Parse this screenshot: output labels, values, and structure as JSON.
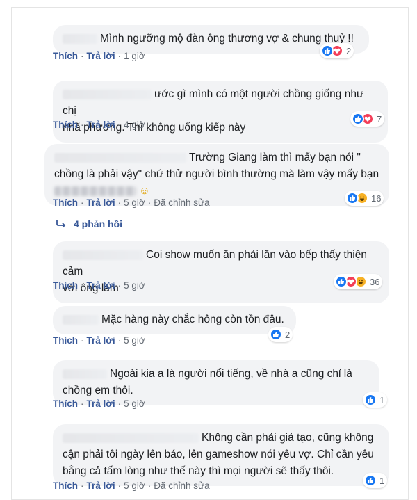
{
  "colors": {
    "link": "#385898",
    "bubble": "#f2f3f5",
    "like": "#1877f2",
    "love": "#f33e58",
    "haha": "#f7b125",
    "muted": "#606770"
  },
  "labels": {
    "like": "Thích",
    "reply": "Trả lời",
    "dot": "·",
    "edited": "Đã chỉnh sửa"
  },
  "replies_toggle": {
    "label": "4 phản hồi",
    "icon": "reply-arrow-icon"
  },
  "comments": [
    {
      "lines": [
        "Mình ngưỡng mộ đàn ông thương vợ & chung thuỷ !!"
      ],
      "time": "1 giờ",
      "reactions": [
        "like",
        "love"
      ],
      "count": "2"
    },
    {
      "lines": [
        "ước gì mình có một người chồng giống như chị",
        "nhã phương. Thì không uổng kiếp này"
      ],
      "time": "4 giờ",
      "reactions": [
        "like",
        "love"
      ],
      "count": "7"
    },
    {
      "lines": [
        "Trường Giang làm thì mấy bạn nói \"",
        "chồng là phải vậy\" chứ thử người bình thường mà làm vậy mấy bạn",
        "☺"
      ],
      "time": "5 giờ",
      "reactions": [
        "like",
        "haha"
      ],
      "count": "16"
    },
    {
      "lines": [
        "Coi show muốn ăn phải lăn vào bếp thấy thiện cảm",
        "với ông lăm"
      ],
      "time": "5 giờ",
      "reactions": [
        "like",
        "love",
        "haha"
      ],
      "count": "36"
    },
    {
      "lines": [
        "Mặc hàng này chắc hông còn tồn đâu."
      ],
      "time": "5 giờ",
      "reactions": [
        "like"
      ],
      "count": "2"
    },
    {
      "lines": [
        "Ngoài kia a là người nổi tiếng, về nhà a cũng chỉ là",
        "chồng em thôi."
      ],
      "time": "5 giờ",
      "reactions": [
        "like"
      ],
      "count": "1"
    },
    {
      "lines": [
        "Không cần phải giả tạo, cũng không",
        "cận phải tôi ngày lên báo, lên gameshow nói yêu vợ. Chỉ cần yêu",
        "bằng cả tấm lòng như thế này thì mọi người sẽ thấy thôi."
      ],
      "time": "5 giờ",
      "reactions": [
        "like"
      ],
      "count": "1"
    }
  ]
}
